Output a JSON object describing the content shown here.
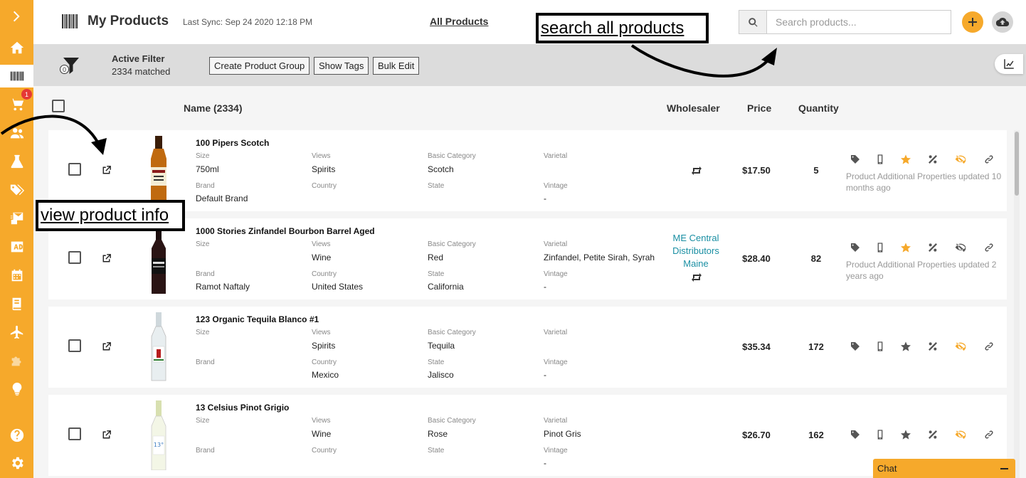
{
  "header": {
    "title": "My Products",
    "last_sync": "Last Sync: Sep 24 2020 12:18 PM",
    "all_products": "All Products",
    "search_placeholder": "Search products..."
  },
  "sidebar": {
    "cart_badge": "1",
    "items": [
      "chevron-right-icon",
      "home-icon",
      "barcode-icon",
      "cart-icon",
      "users-icon",
      "flask-icon",
      "tags-icon",
      "mail-icon",
      "ad-icon",
      "calendar-icon",
      "book-icon",
      "plane-icon",
      "puzzle-icon",
      "lightbulb-icon",
      "help-icon",
      "gear-icon"
    ]
  },
  "filter": {
    "count": "0",
    "title": "Active Filter",
    "matched": "2334 matched",
    "buttons": [
      "Create Product Group",
      "Show Tags",
      "Bulk Edit"
    ]
  },
  "table": {
    "columns": {
      "name": "Name  (2334)",
      "wholesaler": "Wholesaler",
      "price": "Price",
      "quantity": "Quantity"
    },
    "field_labels": {
      "size": "Size",
      "views": "Views",
      "basic_category": "Basic Category",
      "varietal": "Varietal",
      "brand": "Brand",
      "country": "Country",
      "state": "State",
      "vintage": "Vintage"
    },
    "rows": [
      {
        "name": "100 Pipers Scotch",
        "size": "750ml",
        "views": "Spirits",
        "basic_category": "Scotch",
        "varietal": "",
        "brand": "Default Brand",
        "country": "",
        "state": "",
        "vintage": "-",
        "wholesaler": "",
        "price": "$17.50",
        "quantity": "5",
        "updated": "Product Additional Properties updated 10 months ago",
        "starred": true
      },
      {
        "name": "1000 Stories Zinfandel Bourbon Barrel Aged",
        "size": "",
        "views": "Wine",
        "basic_category": "Red",
        "varietal": "Zinfandel, Petite Sirah, Syrah",
        "brand": "Ramot Naftaly",
        "country": "United States",
        "state": "California",
        "vintage": "-",
        "wholesaler": "ME Central Distributors Maine",
        "price": "$28.40",
        "quantity": "82",
        "updated": "Product Additional Properties updated 2 years ago",
        "starred": true
      },
      {
        "name": "123 Organic Tequila Blanco #1",
        "size": "",
        "views": "Spirits",
        "basic_category": "Tequila",
        "varietal": "",
        "brand": "",
        "country": "Mexico",
        "state": "Jalisco",
        "vintage": "-",
        "wholesaler": "",
        "price": "$35.34",
        "quantity": "172",
        "updated": "",
        "starred": false
      },
      {
        "name": "13 Celsius Pinot Grigio",
        "size": "",
        "views": "Wine",
        "basic_category": "Rose",
        "varietal": "Pinot Gris",
        "brand": "",
        "country": "",
        "state": "",
        "vintage": "-",
        "wholesaler": "",
        "price": "$26.70",
        "quantity": "162",
        "updated": "",
        "starred": false
      }
    ]
  },
  "annotations": {
    "search": "search all products",
    "view": "view product info"
  },
  "chat": {
    "label": "Chat"
  },
  "colors": {
    "accent": "#f6a92b",
    "wholesaler_link": "#1a8fa3",
    "hidden_icon": "#f6a92b"
  }
}
